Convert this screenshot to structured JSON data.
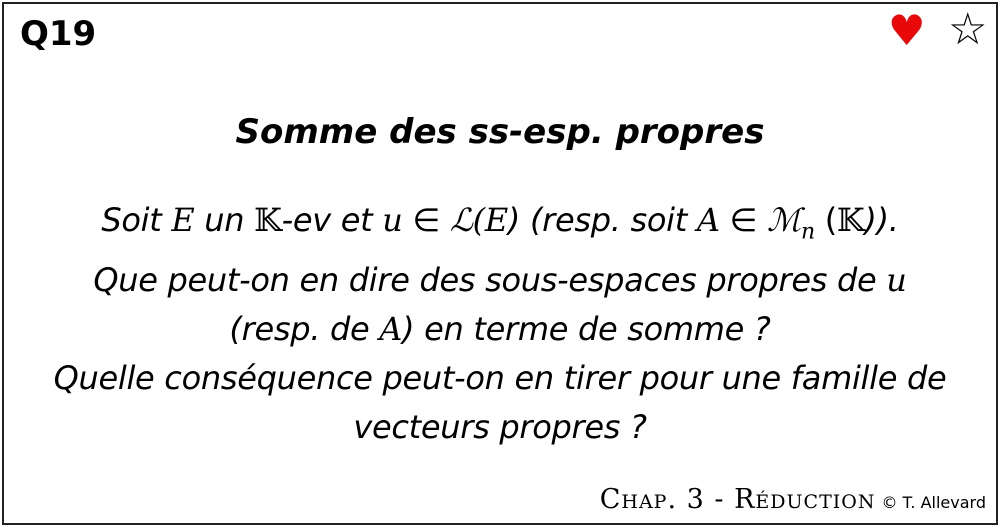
{
  "card": {
    "id": "Q19",
    "heart_icon": "heart-icon",
    "star_icon": "star-outline-icon",
    "heart_color": "#e8080a",
    "title": "Somme des ss-esp. propres",
    "line1": {
      "a": "Soit ",
      "E": "E",
      "b": " un ",
      "K": "𝕂",
      "c": "-ev et ",
      "u": "u",
      "d": " ∈ ",
      "L": "ℒ(",
      "E2": "E",
      "e": ") (resp. soit ",
      "A": "A",
      "f": " ∈ ",
      "M": "ℳ",
      "n": "n",
      "g": " (",
      "K2": "𝕂",
      "h": "))."
    },
    "line2": {
      "a": "Que peut-on en dire des sous-espaces propres de ",
      "u": "u"
    },
    "line3": {
      "a": "(resp. de ",
      "A": "A",
      "b": ") en terme de somme ?"
    },
    "line4": "Quelle conséquence peut-on en tirer pour une famille de",
    "line5": "vecteurs propres ?",
    "footer": {
      "chapter": "Chap. 3 - Réduction",
      "copyright": "© T. Allevard"
    }
  }
}
